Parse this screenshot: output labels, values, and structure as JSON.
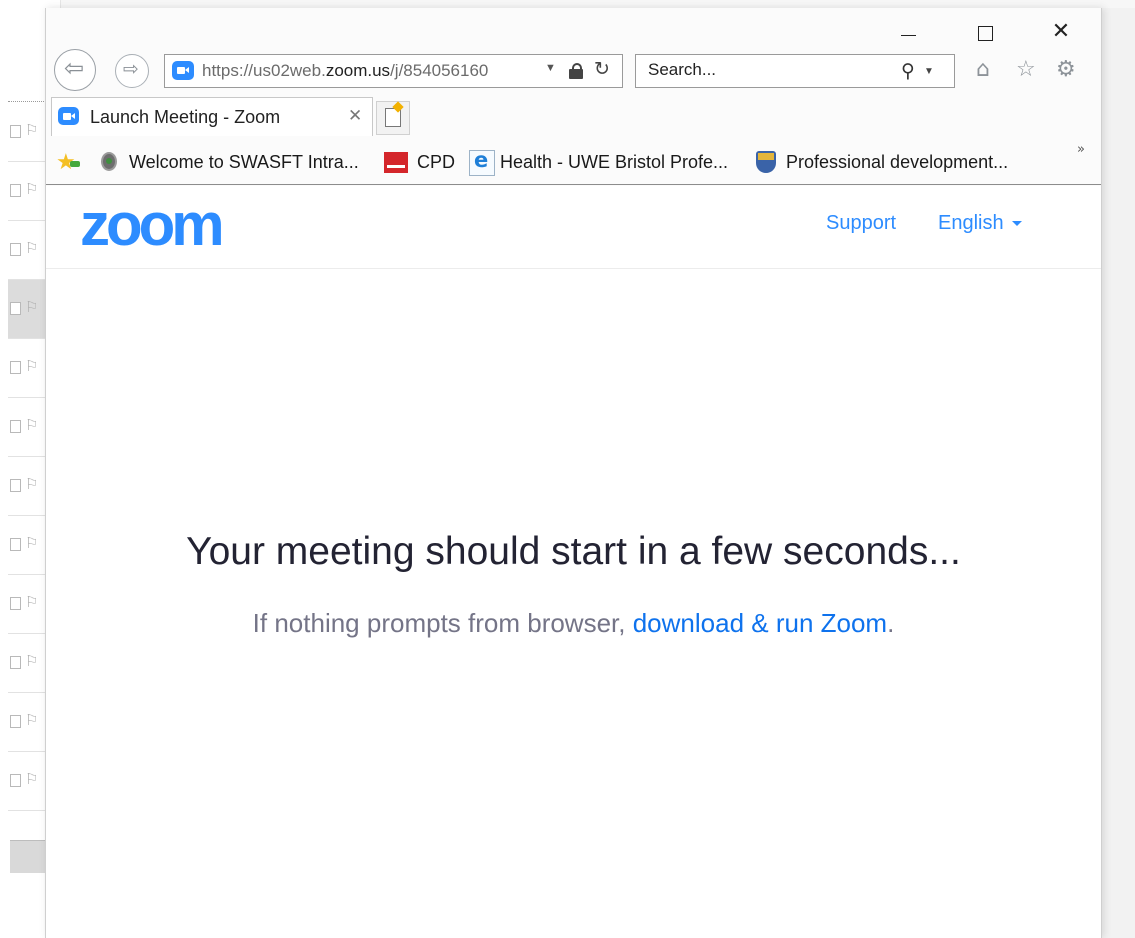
{
  "browser": {
    "address": {
      "scheme": "https://",
      "host_prefix": "us02web.",
      "host_main": "zoom.us",
      "path": "/j/854056160"
    },
    "search": {
      "placeholder": "Search..."
    },
    "tab": {
      "title": "Launch Meeting - Zoom"
    },
    "favorites": [
      {
        "label": "Welcome to SWASFT Intra..."
      },
      {
        "label": "CPD"
      },
      {
        "label": "Health - UWE Bristol Profe..."
      },
      {
        "label": "Professional development..."
      }
    ]
  },
  "zoom_page": {
    "logo": "zoom",
    "nav": {
      "support": "Support",
      "language": "English"
    },
    "headline": "Your meeting should start in a few seconds...",
    "subline_prefix": "If nothing prompts from browser, ",
    "download_link": "download & run Zoom",
    "subline_suffix": "."
  },
  "colors": {
    "zoom_blue": "#2d8cff",
    "link_blue": "#0e72ed"
  },
  "icons": [
    "back-arrow-icon",
    "forward-arrow-icon",
    "lock-icon",
    "refresh-icon",
    "search-icon",
    "home-icon",
    "star-icon",
    "gear-icon",
    "new-tab-icon",
    "favorites-star-icon"
  ]
}
